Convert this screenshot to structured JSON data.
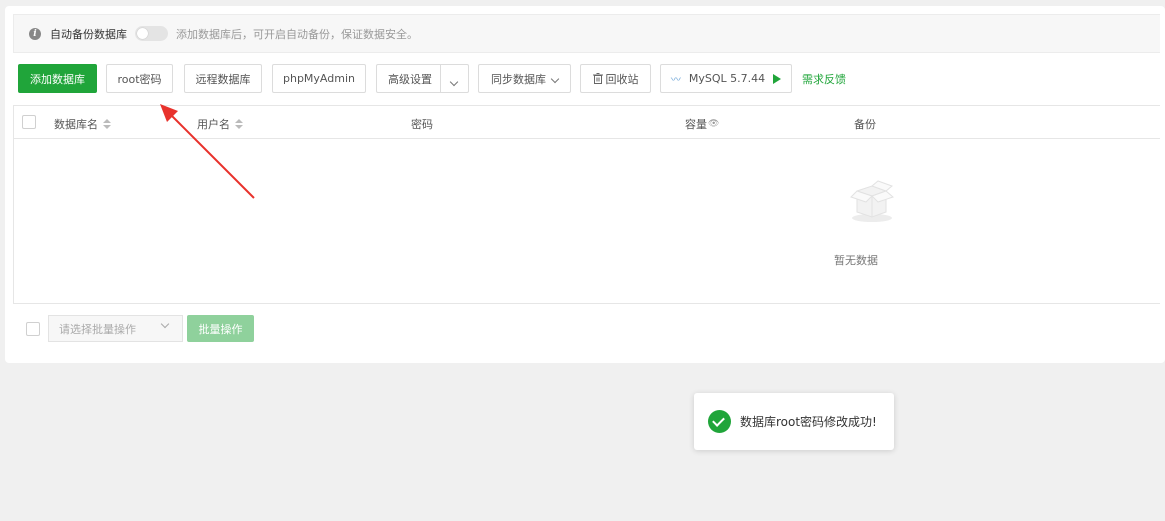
{
  "notice": {
    "label": "自动备份数据库",
    "description": "添加数据库后，可开启自动备份，保证数据安全。"
  },
  "toolbar": {
    "add_db": "添加数据库",
    "root_password": "root密码",
    "remote_db": "远程数据库",
    "phpmyadmin": "phpMyAdmin",
    "advanced": "高级设置",
    "sync_db": "同步数据库",
    "recycle_bin": "回收站",
    "mysql_version": "MySQL 5.7.44",
    "feedback": "需求反馈"
  },
  "table": {
    "columns": [
      "数据库名",
      "用户名",
      "密码",
      "容量",
      "备份"
    ],
    "empty_text": "暂无数据"
  },
  "footer": {
    "batch_placeholder": "请选择批量操作",
    "batch_button": "批量操作"
  },
  "toast": {
    "message": "数据库root密码修改成功!"
  },
  "colors": {
    "accent": "#20a53a",
    "annotation_arrow": "#e8322c"
  }
}
